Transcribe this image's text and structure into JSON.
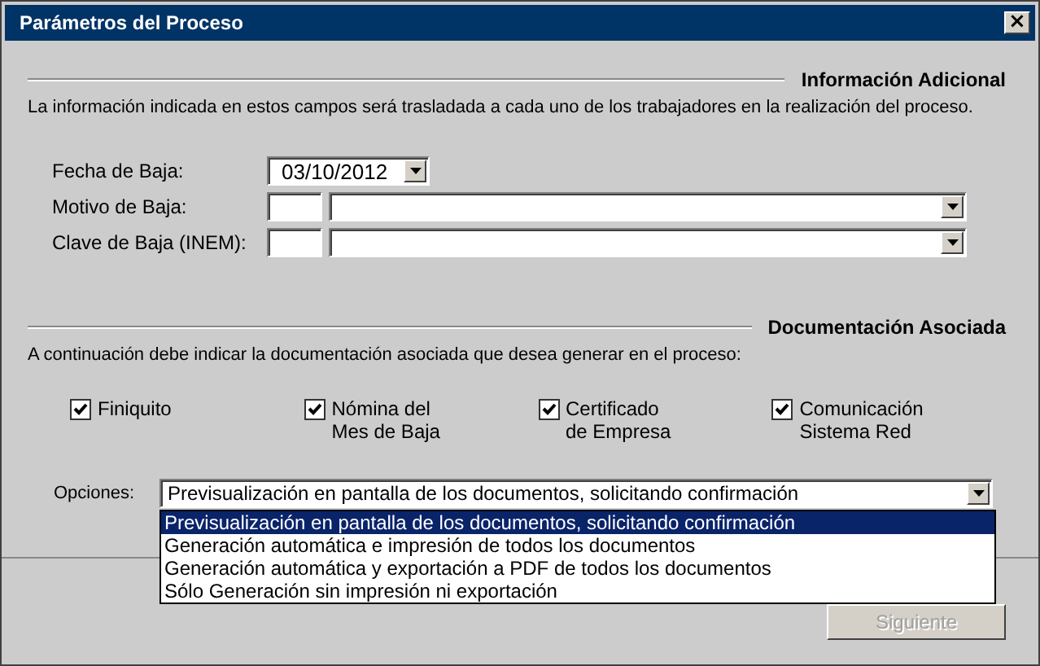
{
  "window": {
    "title": "Parámetros del Proceso",
    "close": "×"
  },
  "sections": [
    {
      "title": "Información Adicional",
      "description": "La información indicada en estos campos será trasladada a cada uno de los trabajadores en la realización del proceso."
    },
    {
      "title": "Documentación Asociada",
      "description": "A continuación debe indicar la documentación asociada que desea generar en el proceso:"
    }
  ],
  "fields": [
    {
      "kind": "date",
      "label": "Fecha de Baja:",
      "value": "03/10/2012"
    },
    {
      "kind": "code",
      "label": "Motivo de Baja:"
    },
    {
      "kind": "code",
      "label": "Clave de Baja (INEM):"
    }
  ],
  "documents": [
    {
      "label": "Finiquito",
      "checked": true
    },
    {
      "label": "Nómina del\nMes de Baja",
      "checked": true
    },
    {
      "label": "Certificado\nde Empresa",
      "checked": true
    },
    {
      "label": "Comunicación\nSistema Red",
      "checked": true
    }
  ],
  "options": {
    "label": "Opciones:",
    "value": "Previsualización en pantalla de los documentos, solicitando confirmación",
    "expanded": true,
    "items": [
      {
        "label": "Previsualización en pantalla de los documentos, solicitando confirmación",
        "selected": true
      },
      {
        "label": "Generación automática e impresión de todos los documentos",
        "selected": false
      },
      {
        "label": "Generación automática y exportación a PDF de todos los documentos",
        "selected": false
      },
      {
        "label": "Sólo Generación sin impresión ni exportación",
        "selected": false
      }
    ]
  },
  "buttons": [
    {
      "label": "Siguiente",
      "disabled": true
    }
  ]
}
